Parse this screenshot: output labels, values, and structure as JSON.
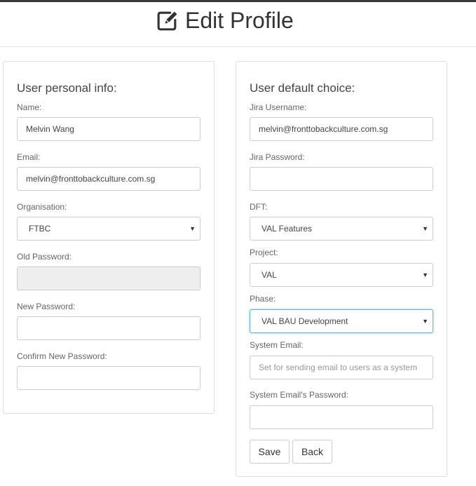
{
  "header": {
    "title": "Edit Profile",
    "icon": "edit-icon"
  },
  "personal": {
    "heading": "User personal info:",
    "name_label": "Name:",
    "name_value": "Melvin Wang",
    "email_label": "Email:",
    "email_value": "melvin@fronttobackculture.com.sg",
    "org_label": "Organisation:",
    "org_value": "FTBC",
    "old_password_label": "Old Password:",
    "old_password_value": "",
    "new_password_label": "New Password:",
    "new_password_value": "",
    "confirm_password_label": "Confirm New Password:",
    "confirm_password_value": ""
  },
  "defaults": {
    "heading": "User default choice:",
    "jira_username_label": "Jira Username:",
    "jira_username_value": "melvin@fronttobackculture.com.sg",
    "jira_password_label": "Jira Password:",
    "jira_password_value": "",
    "dft_label": "DFT:",
    "dft_value": "VAL Features",
    "project_label": "Project:",
    "project_value": "VAL",
    "phase_label": "Phase:",
    "phase_value": "VAL BAU Development",
    "system_email_label": "System Email:",
    "system_email_placeholder": "Set for sending email to users as a system",
    "system_email_password_label": "System Email's Password:",
    "system_email_password_value": ""
  },
  "actions": {
    "save_label": "Save",
    "back_label": "Back"
  },
  "colors": {
    "focus_border": "#66afe9",
    "disabled_bg": "#eeeeee",
    "top_bar": "#3a3a3a"
  }
}
